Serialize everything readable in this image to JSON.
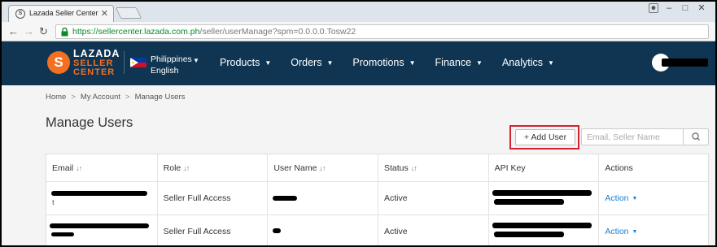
{
  "browser": {
    "tab_title": "Lazada Seller Center",
    "tab_close": "✕",
    "url_host": "https://sellercenter.lazada.com.ph",
    "url_path": "/seller/userManage?spm=0.0.0.0.Tosw22",
    "back": "←",
    "forward": "→",
    "reload": "C"
  },
  "topnav": {
    "logo_mark": "S",
    "logo_line1": "LAZADA",
    "logo_line2": "SELLER",
    "logo_line3": "CENTER",
    "country": "Philippines",
    "language": "English",
    "menu": [
      {
        "label": "Products"
      },
      {
        "label": "Orders"
      },
      {
        "label": "Promotions"
      },
      {
        "label": "Finance"
      },
      {
        "label": "Analytics"
      }
    ],
    "colors": {
      "bg": "#0f3552",
      "brand": "#f36f21"
    }
  },
  "breadcrumb": [
    "Home",
    "My Account",
    "Manage Users"
  ],
  "breadcrumb_sep": ">",
  "page_title": "Manage Users",
  "toolbar": {
    "add_user_label": "+ Add User",
    "search_placeholder": "Email, Seller Name"
  },
  "table": {
    "columns": [
      {
        "label": "Email",
        "sortable": true
      },
      {
        "label": "Role",
        "sortable": true
      },
      {
        "label": "User Name",
        "sortable": true
      },
      {
        "label": "Status",
        "sortable": true
      },
      {
        "label": "API Key",
        "sortable": false
      },
      {
        "label": "Actions",
        "sortable": false
      }
    ],
    "sort_glyph": "↓↑",
    "rows": [
      {
        "email_visible": "t",
        "role": "Seller Full Access",
        "status": "Active",
        "action": "Action"
      },
      {
        "email_visible": "",
        "role": "Seller Full Access",
        "status": "Active",
        "action": "Action"
      }
    ]
  }
}
